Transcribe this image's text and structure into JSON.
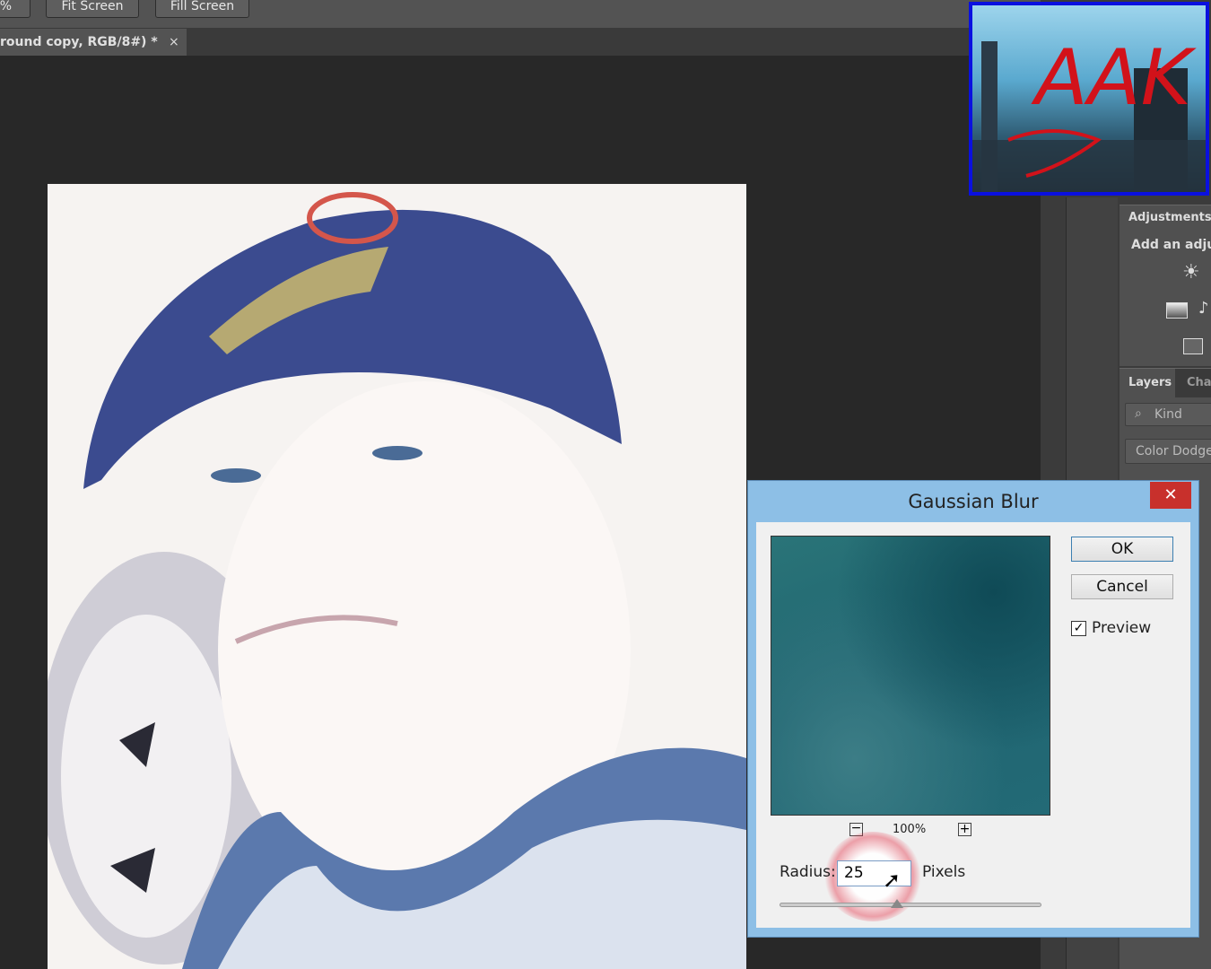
{
  "options_bar": {
    "zoom_fragment": "%",
    "fit_screen": "Fit Screen",
    "fill_screen": "Fill Screen"
  },
  "document_tab": {
    "title": "round copy, RGB/8#) *",
    "close": "×"
  },
  "adjustments_panel": {
    "title": "Adjustments",
    "subtitle": "Add an adju"
  },
  "layers_panel": {
    "tab_layers": "Layers",
    "tab_channels": "Cha",
    "filter_kind": "Kind",
    "blend_mode": "Color Dodge"
  },
  "watermark": {
    "text": "AAK"
  },
  "dialog": {
    "title": "Gaussian Blur",
    "close": "✕",
    "ok": "OK",
    "cancel": "Cancel",
    "preview_label": "Preview",
    "preview_checked": true,
    "zoom": "100%",
    "radius_label": "Radius:",
    "radius_value": "25",
    "units": "Pixels",
    "slider_fraction": 0.45
  }
}
